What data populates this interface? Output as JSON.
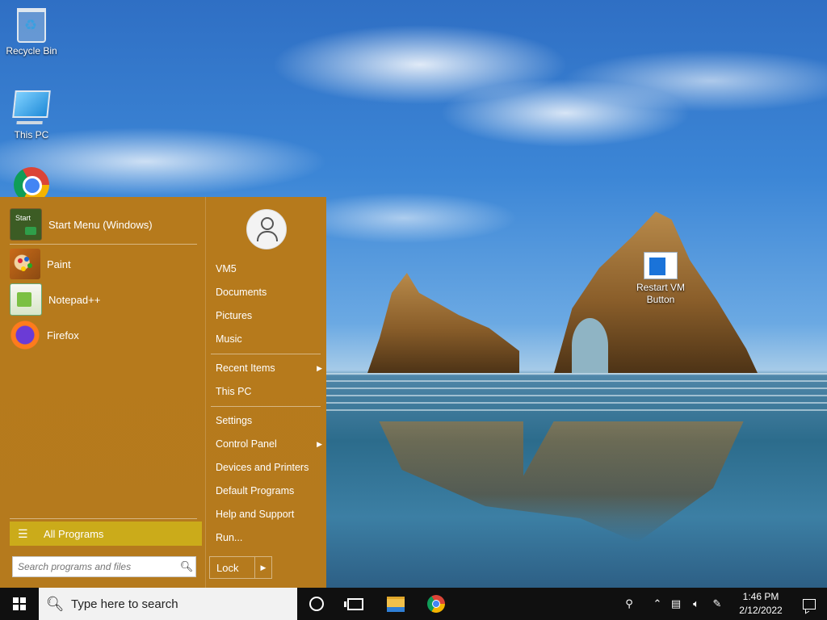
{
  "desktop": {
    "icons": [
      {
        "label": "Recycle Bin",
        "icon": "recycle-bin-icon"
      },
      {
        "label": "This PC",
        "icon": "this-pc-icon"
      },
      {
        "label": "",
        "icon": "chrome-icon"
      },
      {
        "label": "Restart VM Button",
        "icon": "restart-vm-icon"
      }
    ]
  },
  "start_menu": {
    "programs": [
      {
        "label": "Start Menu (Windows)",
        "icon": "start-menu-icon"
      },
      {
        "label": "Paint",
        "icon": "paint-icon"
      },
      {
        "label": "Notepad++",
        "icon": "notepad-plus-plus-icon"
      },
      {
        "label": "Firefox",
        "icon": "firefox-icon"
      }
    ],
    "all_programs": "All Programs",
    "search_placeholder": "Search programs and files",
    "right_items": [
      {
        "label": "VM5"
      },
      {
        "label": "Documents"
      },
      {
        "label": "Pictures"
      },
      {
        "label": "Music"
      },
      {
        "label": "Recent Items",
        "submenu": true
      },
      {
        "label": "This PC"
      },
      {
        "label": "Settings"
      },
      {
        "label": "Control Panel",
        "submenu": true
      },
      {
        "label": "Devices and Printers"
      },
      {
        "label": "Default Programs"
      },
      {
        "label": "Help and Support"
      },
      {
        "label": "Run..."
      }
    ],
    "lock_label": "Lock",
    "accent_color": "#b67a1c",
    "highlight_color": "#cbab1a"
  },
  "taskbar": {
    "search_placeholder": "Type here to search",
    "pinned": [
      "cortana-icon",
      "task-view-icon",
      "file-explorer-icon",
      "chrome-icon"
    ],
    "tray": [
      "people-icon",
      "chevron-up-icon",
      "network-icon",
      "volume-icon",
      "pen-icon"
    ],
    "time": "1:46 PM",
    "date": "2/12/2022"
  }
}
